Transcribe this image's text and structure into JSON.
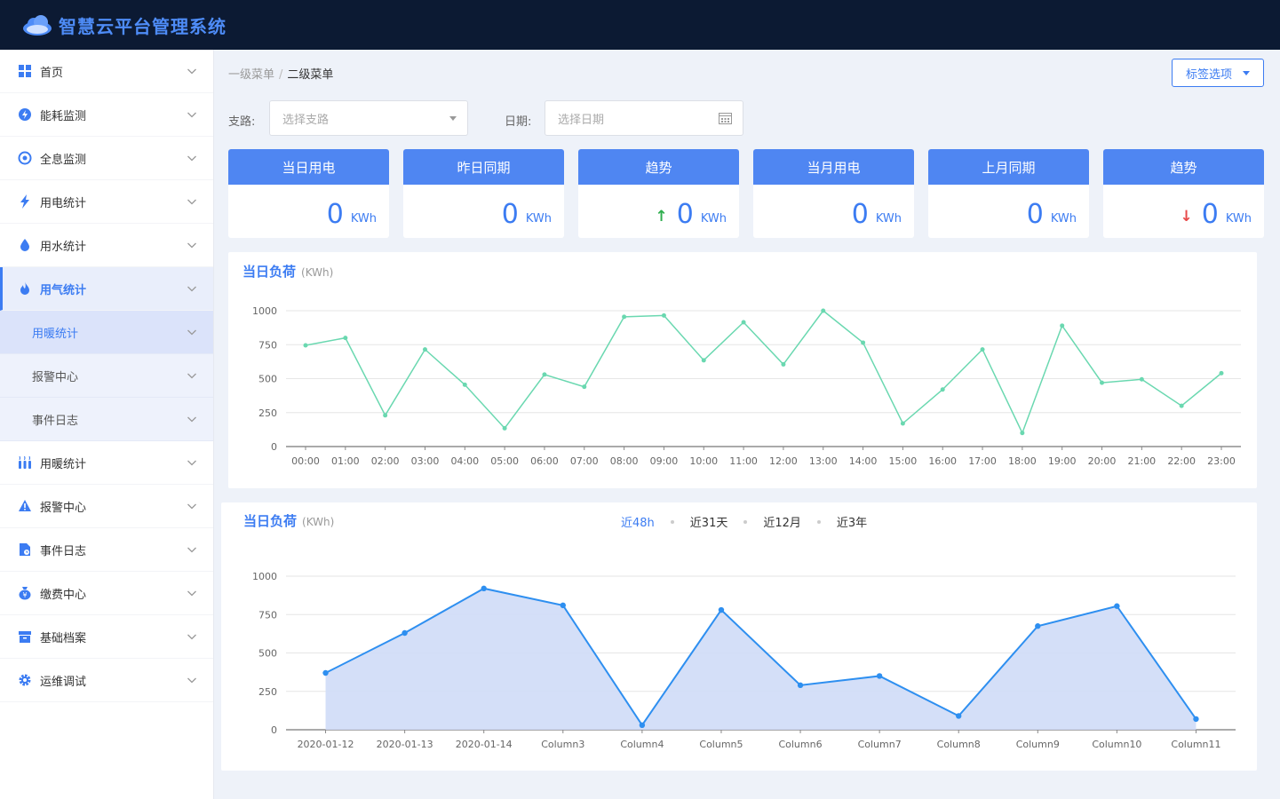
{
  "app": {
    "title": "智慧云平台管理系统"
  },
  "sidebar": {
    "items": [
      {
        "label": "首页",
        "icon": "dashboard-icon"
      },
      {
        "label": "能耗监测",
        "icon": "energy-icon"
      },
      {
        "label": "全息监测",
        "icon": "target-icon"
      },
      {
        "label": "用电统计",
        "icon": "lightning-icon"
      },
      {
        "label": "用水统计",
        "icon": "water-drop-icon"
      },
      {
        "label": "用气统计",
        "icon": "flame-icon",
        "active": true
      },
      {
        "label": "用暖统计",
        "icon": "heater-icon"
      },
      {
        "label": "报警中心",
        "icon": "warning-icon"
      },
      {
        "label": "事件日志",
        "icon": "document-icon"
      },
      {
        "label": "缴费中心",
        "icon": "money-bag-icon"
      },
      {
        "label": "基础档案",
        "icon": "archive-icon"
      },
      {
        "label": "运维调试",
        "icon": "gear-icon"
      }
    ],
    "submenu": [
      {
        "label": "用暖统计",
        "selected": true
      },
      {
        "label": "报警中心"
      },
      {
        "label": "事件日志"
      }
    ]
  },
  "breadcrumb": {
    "level1": "一级菜单",
    "separator": "/",
    "level2": "二级菜单"
  },
  "tag_button": "标签选项",
  "filters": {
    "branch_label": "支路:",
    "branch_placeholder": "选择支路",
    "date_label": "日期:",
    "date_placeholder": "选择日期"
  },
  "cards": [
    {
      "title": "当日用电",
      "value": "0",
      "unit": "KWh",
      "trend": ""
    },
    {
      "title": "昨日同期",
      "value": "0",
      "unit": "KWh",
      "trend": ""
    },
    {
      "title": "趋势",
      "value": "0",
      "unit": "KWh",
      "trend": "up"
    },
    {
      "title": "当月用电",
      "value": "0",
      "unit": "KWh",
      "trend": ""
    },
    {
      "title": "上月同期",
      "value": "0",
      "unit": "KWh",
      "trend": ""
    },
    {
      "title": "趋势",
      "value": "0",
      "unit": "KWh",
      "trend": "down"
    }
  ],
  "trend_symbols": {
    "up": "↑",
    "down": "↓"
  },
  "colors": {
    "accent": "#3c7cf2",
    "line1": "#6ad8b0",
    "line2": "#2e8ff0",
    "area2": "#cfdcf7",
    "up": "#2fae4e",
    "down": "#e84a4a"
  },
  "panel1": {
    "title": "当日负荷",
    "unit": "(KWh)"
  },
  "panel2": {
    "title": "当日负荷",
    "unit": "(KWh)",
    "ranges": [
      "近48h",
      "近31天",
      "近12月",
      "近3年"
    ],
    "active_range": 0
  },
  "chart_data": [
    {
      "type": "line",
      "categories": [
        "00:00",
        "01:00",
        "02:00",
        "03:00",
        "04:00",
        "05:00",
        "06:00",
        "07:00",
        "08:00",
        "09:00",
        "10:00",
        "11:00",
        "12:00",
        "13:00",
        "14:00",
        "15:00",
        "16:00",
        "17:00",
        "18:00",
        "19:00",
        "20:00",
        "21:00",
        "22:00",
        "23:00"
      ],
      "values": [
        745,
        800,
        230,
        715,
        455,
        135,
        530,
        440,
        955,
        965,
        635,
        915,
        605,
        1000,
        765,
        170,
        420,
        715,
        100,
        890,
        470,
        495,
        300,
        540
      ],
      "ylim": [
        0,
        1000
      ],
      "yticks": [
        0,
        250,
        500,
        750,
        1000
      ],
      "grid": true
    },
    {
      "type": "area",
      "categories": [
        "2020-01-12",
        "2020-01-13",
        "2020-01-14",
        "Column3",
        "Column4",
        "Column5",
        "Column6",
        "Column7",
        "Column8",
        "Column9",
        "Column10",
        "Column11"
      ],
      "values": [
        370,
        630,
        920,
        810,
        30,
        780,
        290,
        350,
        90,
        675,
        805,
        70
      ],
      "ylim": [
        0,
        1000
      ],
      "yticks": [
        0,
        250,
        500,
        750,
        1000
      ],
      "grid": true
    }
  ]
}
